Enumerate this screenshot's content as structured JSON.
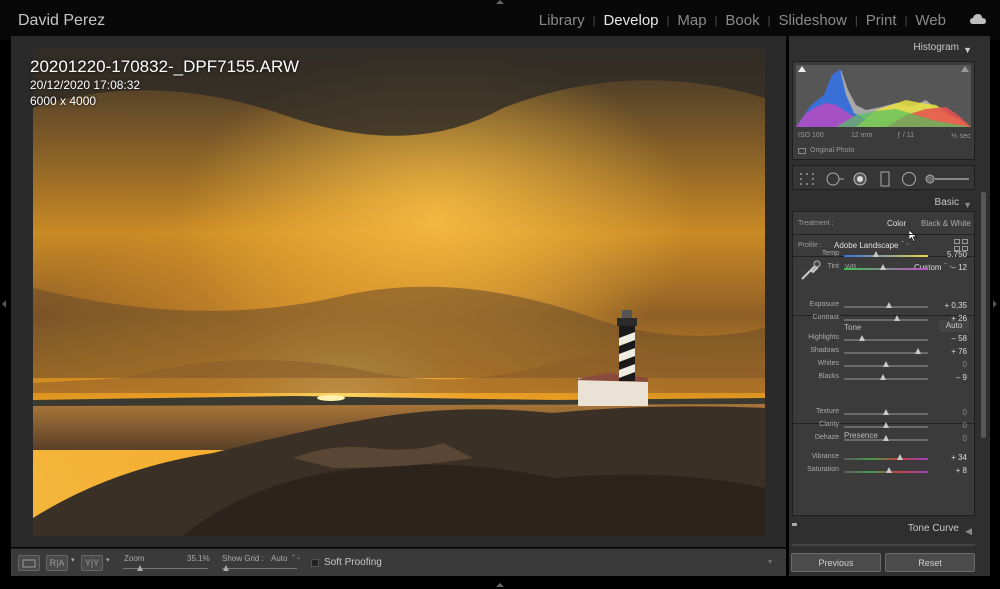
{
  "app": {
    "identity_plate": "David Perez"
  },
  "modules": [
    {
      "label": "Library",
      "active": false
    },
    {
      "label": "Develop",
      "active": true
    },
    {
      "label": "Map",
      "active": false
    },
    {
      "label": "Book",
      "active": false
    },
    {
      "label": "Slideshow",
      "active": false
    },
    {
      "label": "Print",
      "active": false
    },
    {
      "label": "Web",
      "active": false
    }
  ],
  "module_separator": "|",
  "photo_info": {
    "filename": "20201220-170832-_DPF7155.ARW",
    "datetime": "20/12/2020 17:08:32",
    "dimensions": "6000 x 4000"
  },
  "toolbar": {
    "view_icon": "loupe-view-icon",
    "ra_label": "R|A",
    "yy_label": "Y|Y",
    "zoom_label": "Zoom",
    "zoom_value": "35.1%",
    "zoom_level": 0.2,
    "show_grid_label": "Show Grid :",
    "show_grid_value": "Auto",
    "show_grid_level": 0.05,
    "soft_proofing_label": "Soft Proofing",
    "soft_proofing_checked": false
  },
  "histogram": {
    "title": "Histogram",
    "iso": "ISO 100",
    "focal": "12 mm",
    "aperture": "ƒ / 11",
    "shutter": "⅕ sec",
    "original_photo_label": "Original Photo"
  },
  "basic": {
    "title": "Basic",
    "treatment_label": "Treatment :",
    "treatment_color": "Color",
    "treatment_bw": "Black & White",
    "profile_label": "Profile :",
    "profile_value": "Adobe Landscape",
    "wb_label": "WB :",
    "wb_value": "Custom",
    "tone_label": "Tone",
    "auto_label": "Auto",
    "presence_label": "Presence",
    "sliders": [
      {
        "id": "temp",
        "label": "Temp",
        "value": "5.750",
        "pos": 0.38,
        "type": "temp"
      },
      {
        "id": "tint",
        "label": "Tint",
        "value": "– 12",
        "pos": 0.46,
        "type": "tint"
      },
      {
        "id": "exposure",
        "label": "Exposure",
        "value": "+ 0,35",
        "pos": 0.53,
        "type": "gray"
      },
      {
        "id": "contrast",
        "label": "Contrast",
        "value": "+ 26",
        "pos": 0.63,
        "type": "gray"
      },
      {
        "id": "highlights",
        "label": "Highlights",
        "value": "– 58",
        "pos": 0.21,
        "type": "gray"
      },
      {
        "id": "shadows",
        "label": "Shadows",
        "value": "+ 76",
        "pos": 0.88,
        "type": "gray"
      },
      {
        "id": "whites",
        "label": "Whites",
        "value": "0",
        "pos": 0.5,
        "type": "gray"
      },
      {
        "id": "blacks",
        "label": "Blacks",
        "value": "– 9",
        "pos": 0.46,
        "type": "gray"
      },
      {
        "id": "texture",
        "label": "Texture",
        "value": "0",
        "pos": 0.5,
        "type": "gray"
      },
      {
        "id": "clarity",
        "label": "Clarity",
        "value": "0",
        "pos": 0.5,
        "type": "gray"
      },
      {
        "id": "dehaze",
        "label": "Dehaze",
        "value": "0",
        "pos": 0.5,
        "type": "gray"
      },
      {
        "id": "vibrance",
        "label": "Vibrance",
        "value": "+ 34",
        "pos": 0.67,
        "type": "color"
      },
      {
        "id": "saturation",
        "label": "Saturation",
        "value": "+ 8",
        "pos": 0.54,
        "type": "color"
      }
    ]
  },
  "tone_curve": {
    "title": "Tone Curve"
  },
  "buttons": {
    "previous": "Previous",
    "reset": "Reset"
  },
  "colors": {
    "accent_text": "#e8e8e8",
    "panel": "#2f2f2f",
    "viewer": "#2a2a2a"
  }
}
